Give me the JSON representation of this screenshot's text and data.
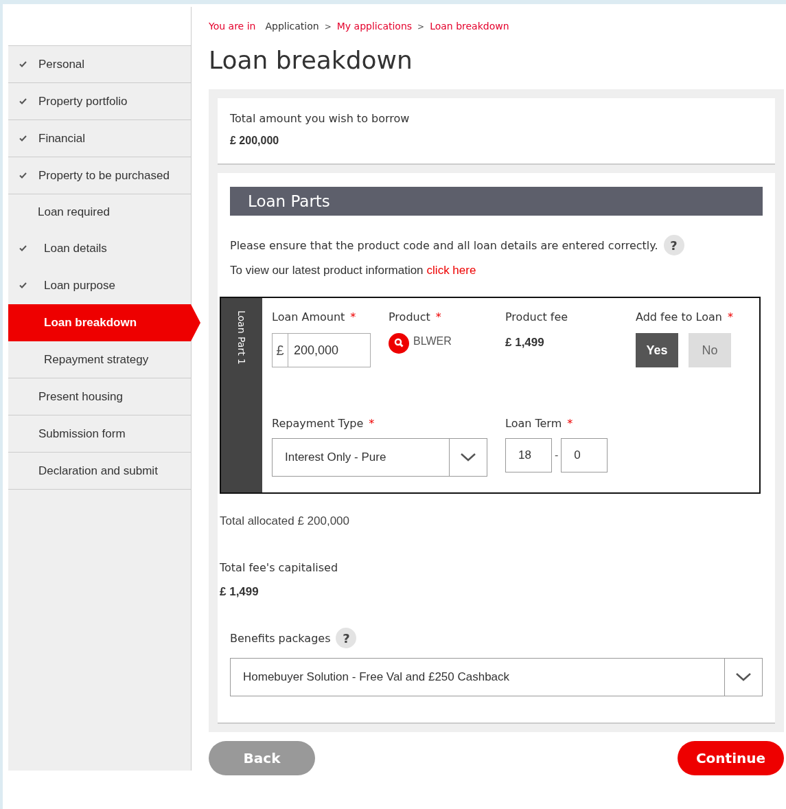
{
  "sidebar": {
    "items": [
      {
        "label": "Personal",
        "kind": "section",
        "checked": true,
        "selected": false
      },
      {
        "label": "Property portfolio",
        "kind": "section",
        "checked": true,
        "selected": false
      },
      {
        "label": "Financial",
        "kind": "section",
        "checked": true,
        "selected": false
      },
      {
        "label": "Property to be purchased",
        "kind": "section",
        "checked": true,
        "selected": false
      },
      {
        "label": "Loan required",
        "kind": "group",
        "checked": false,
        "selected": false
      },
      {
        "label": "Loan details",
        "kind": "step",
        "checked": true,
        "selected": false
      },
      {
        "label": "Loan purpose",
        "kind": "step",
        "checked": true,
        "selected": false
      },
      {
        "label": "Loan breakdown",
        "kind": "step",
        "checked": false,
        "selected": true
      },
      {
        "label": "Repayment strategy",
        "kind": "step",
        "checked": false,
        "selected": false
      },
      {
        "label": "Present housing",
        "kind": "section",
        "checked": false,
        "selected": false
      },
      {
        "label": "Submission form",
        "kind": "section",
        "checked": false,
        "selected": false
      },
      {
        "label": "Declaration and submit",
        "kind": "section",
        "checked": false,
        "selected": false
      }
    ]
  },
  "breadcrumb": {
    "prefix": "You are in",
    "separator": ">",
    "items": [
      {
        "label": "Application",
        "link": false
      },
      {
        "label": "My applications",
        "link": true
      },
      {
        "label": "Loan breakdown",
        "link": true
      }
    ]
  },
  "title": "Loan breakdown",
  "borrow": {
    "label": "Total amount you wish to borrow",
    "value": "£ 200,000"
  },
  "loan_parts": {
    "heading": "Loan Parts",
    "notice": "Please ensure that the product code and all loan details are entered correctly.",
    "help": "?",
    "info_text": "To view our latest product information",
    "info_link": "click here",
    "parts": [
      {
        "tab": "Loan Part 1",
        "loan_amount": {
          "label": "Loan Amount",
          "asterisk": "*",
          "currency": "£",
          "value": "200,000"
        },
        "product": {
          "label": "Product",
          "asterisk": "*",
          "code": "BLWER"
        },
        "product_fee": {
          "label": "Product fee",
          "value": "£ 1,499"
        },
        "add_fee": {
          "label": "Add fee to Loan",
          "asterisk": "*",
          "options": [
            {
              "label": "Yes",
              "selected": true
            },
            {
              "label": "No",
              "selected": false
            }
          ]
        },
        "repayment_type": {
          "label": "Repayment Type",
          "asterisk": "*",
          "value": "Interest Only - Pure"
        },
        "loan_term": {
          "label": "Loan Term",
          "asterisk": "*",
          "years": "18",
          "separator": "-",
          "months": "0"
        }
      }
    ]
  },
  "total_allocated": "Total allocated £ 200,000",
  "fees_capitalised": {
    "label": "Total fee's capitalised",
    "value": "£ 1,499"
  },
  "benefits": {
    "label": "Benefits packages",
    "help": "?",
    "value": "Homebuyer Solution - Free Val and £250 Cashback"
  },
  "buttons": {
    "back": "Back",
    "continue": "Continue"
  }
}
